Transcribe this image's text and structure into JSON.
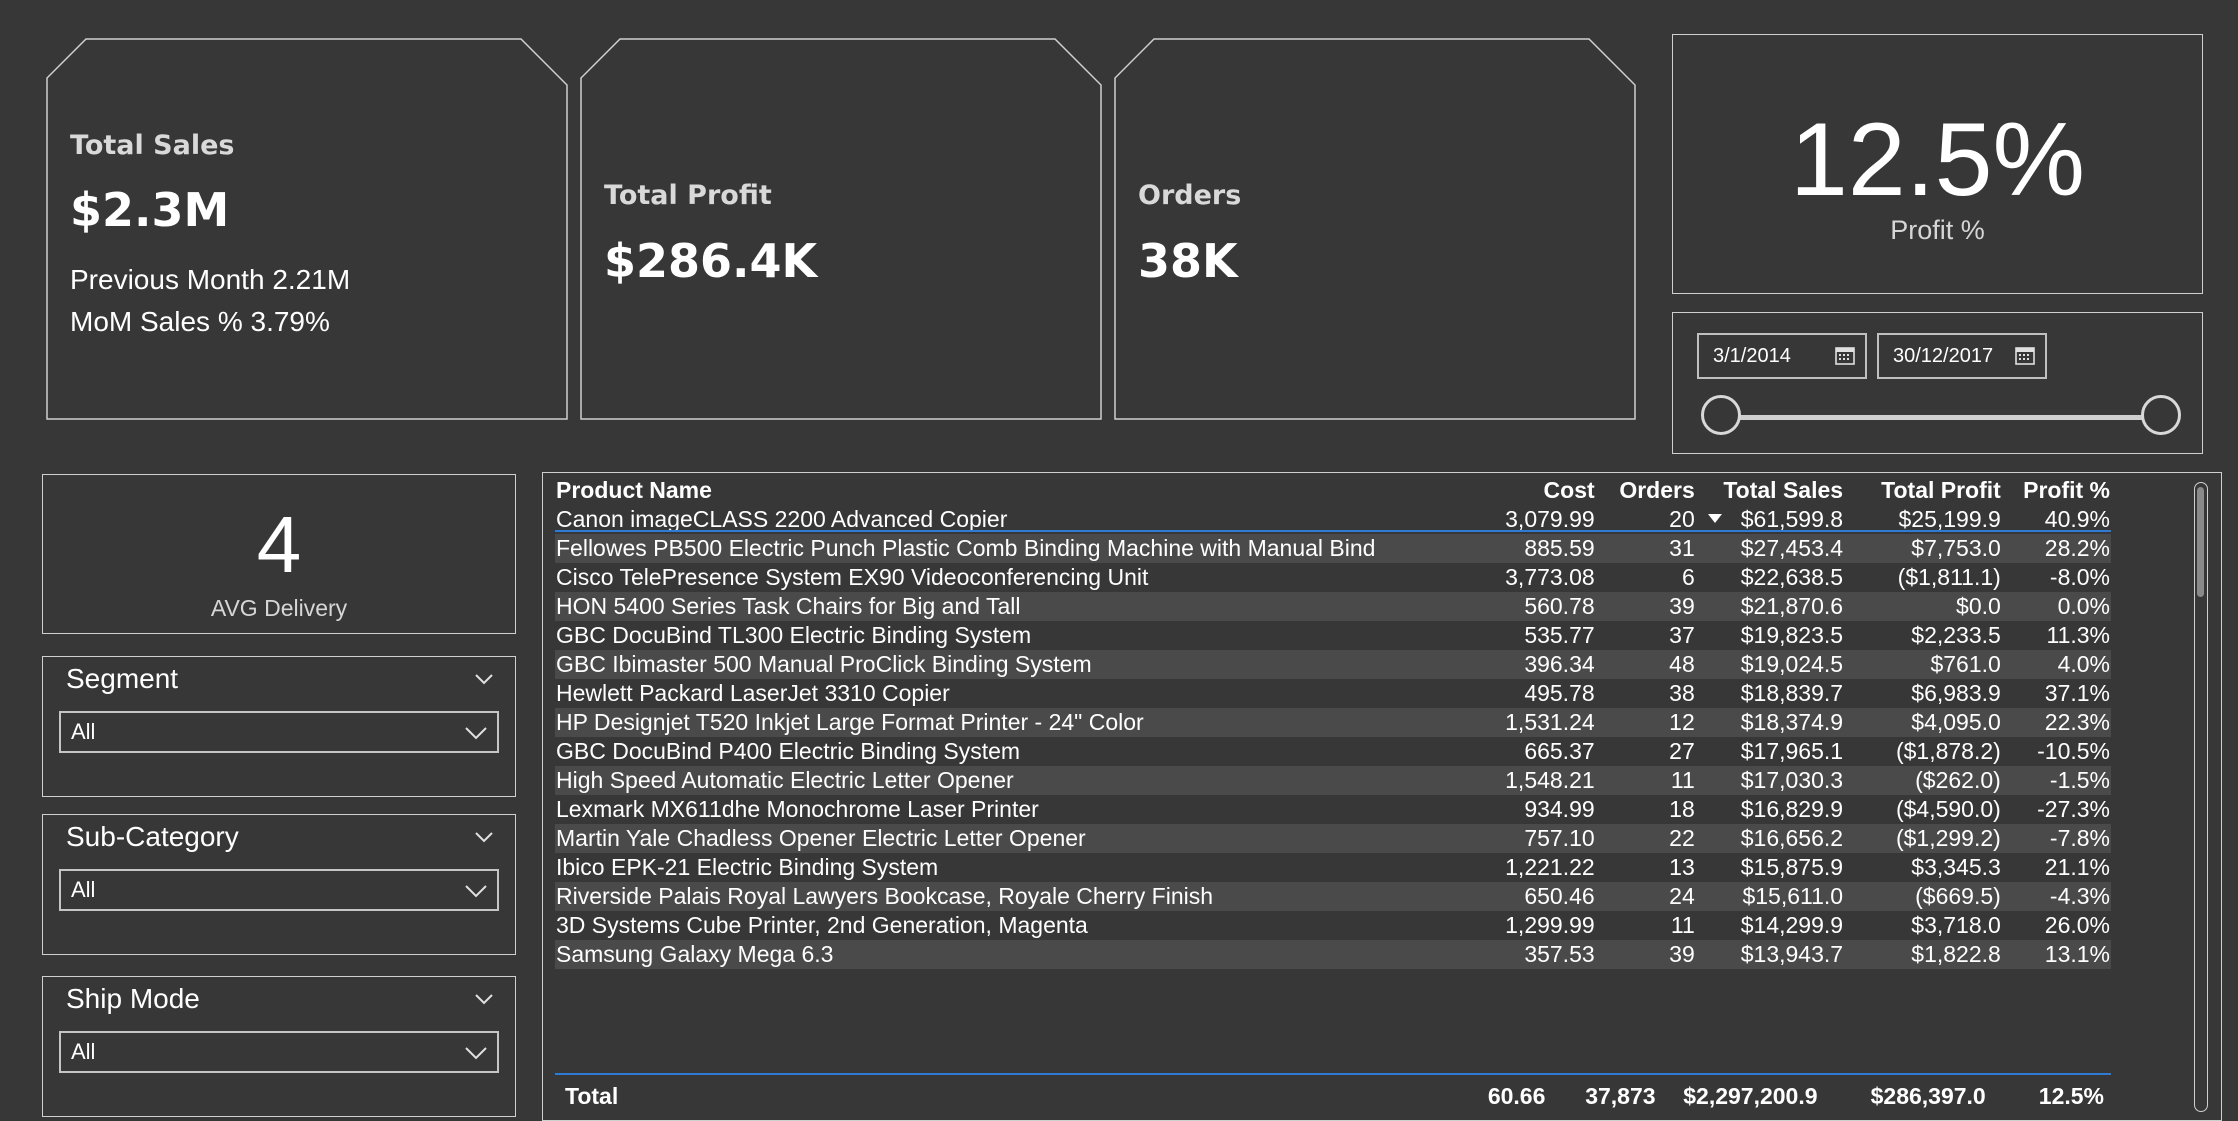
{
  "kpis": {
    "total_sales": {
      "title": "Total Sales",
      "value": "$2.3M",
      "prev": "Previous Month 2.21M",
      "mom": "MoM Sales % 3.79%"
    },
    "total_profit": {
      "title": "Total Profit",
      "value": "$286.4K"
    },
    "orders": {
      "title": "Orders",
      "value": "38K"
    },
    "profit_pct": {
      "value": "12.5%",
      "caption": "Profit %"
    },
    "avg_delivery": {
      "value": "4",
      "caption": "AVG Delivery"
    }
  },
  "date_range": {
    "start": "3/1/2014",
    "end": "30/12/2017",
    "icons": [
      "calendar-icon",
      "calendar-icon"
    ]
  },
  "slicers": {
    "segment": {
      "title": "Segment",
      "value": "All"
    },
    "sub_category": {
      "title": "Sub-Category",
      "value": "All"
    },
    "ship_mode": {
      "title": "Ship Mode",
      "value": "All"
    }
  },
  "table": {
    "columns": [
      "Product Name",
      "Cost",
      "Orders",
      "Total Sales",
      "Total Profit",
      "Profit %"
    ],
    "rows": [
      [
        "Canon imageCLASS 2200 Advanced Copier",
        "3,079.99",
        "20",
        "$61,599.8",
        "$25,199.9",
        "40.9%"
      ],
      [
        "Fellowes PB500 Electric Punch Plastic Comb Binding Machine with Manual Bind",
        "885.59",
        "31",
        "$27,453.4",
        "$7,753.0",
        "28.2%"
      ],
      [
        "Cisco TelePresence System EX90 Videoconferencing Unit",
        "3,773.08",
        "6",
        "$22,638.5",
        "($1,811.1)",
        "-8.0%"
      ],
      [
        "HON 5400 Series Task Chairs for Big and Tall",
        "560.78",
        "39",
        "$21,870.6",
        "$0.0",
        "0.0%"
      ],
      [
        "GBC DocuBind TL300 Electric Binding System",
        "535.77",
        "37",
        "$19,823.5",
        "$2,233.5",
        "11.3%"
      ],
      [
        "GBC Ibimaster 500 Manual ProClick Binding System",
        "396.34",
        "48",
        "$19,024.5",
        "$761.0",
        "4.0%"
      ],
      [
        "Hewlett Packard LaserJet 3310 Copier",
        "495.78",
        "38",
        "$18,839.7",
        "$6,983.9",
        "37.1%"
      ],
      [
        "HP Designjet T520 Inkjet Large Format Printer - 24\" Color",
        "1,531.24",
        "12",
        "$18,374.9",
        "$4,095.0",
        "22.3%"
      ],
      [
        "GBC DocuBind P400 Electric Binding System",
        "665.37",
        "27",
        "$17,965.1",
        "($1,878.2)",
        "-10.5%"
      ],
      [
        "High Speed Automatic Electric Letter Opener",
        "1,548.21",
        "11",
        "$17,030.3",
        "($262.0)",
        "-1.5%"
      ],
      [
        "Lexmark MX611dhe Monochrome Laser Printer",
        "934.99",
        "18",
        "$16,829.9",
        "($4,590.0)",
        "-27.3%"
      ],
      [
        "Martin Yale Chadless Opener Electric Letter Opener",
        "757.10",
        "22",
        "$16,656.2",
        "($1,299.2)",
        "-7.8%"
      ],
      [
        "Ibico EPK-21 Electric Binding System",
        "1,221.22",
        "13",
        "$15,875.9",
        "$3,345.3",
        "21.1%"
      ],
      [
        "Riverside Palais Royal Lawyers Bookcase, Royale Cherry Finish",
        "650.46",
        "24",
        "$15,611.0",
        "($669.5)",
        "-4.3%"
      ],
      [
        "3D Systems Cube Printer, 2nd Generation, Magenta",
        "1,299.99",
        "11",
        "$14,299.9",
        "$3,718.0",
        "26.0%"
      ],
      [
        "Samsung Galaxy Mega 6.3",
        "357.53",
        "39",
        "$13,943.7",
        "$1,822.8",
        "13.1%"
      ]
    ],
    "total": {
      "label": "Total",
      "cost": "60.66",
      "orders": "37,873",
      "sales": "$2,297,200.9",
      "profit": "$286,397.0",
      "pct": "12.5%"
    }
  },
  "colors": {
    "background": "#373737",
    "border": "#cfcfcf",
    "row_alt": "#4a4a4a",
    "accent_line": "#2e7bd6"
  }
}
